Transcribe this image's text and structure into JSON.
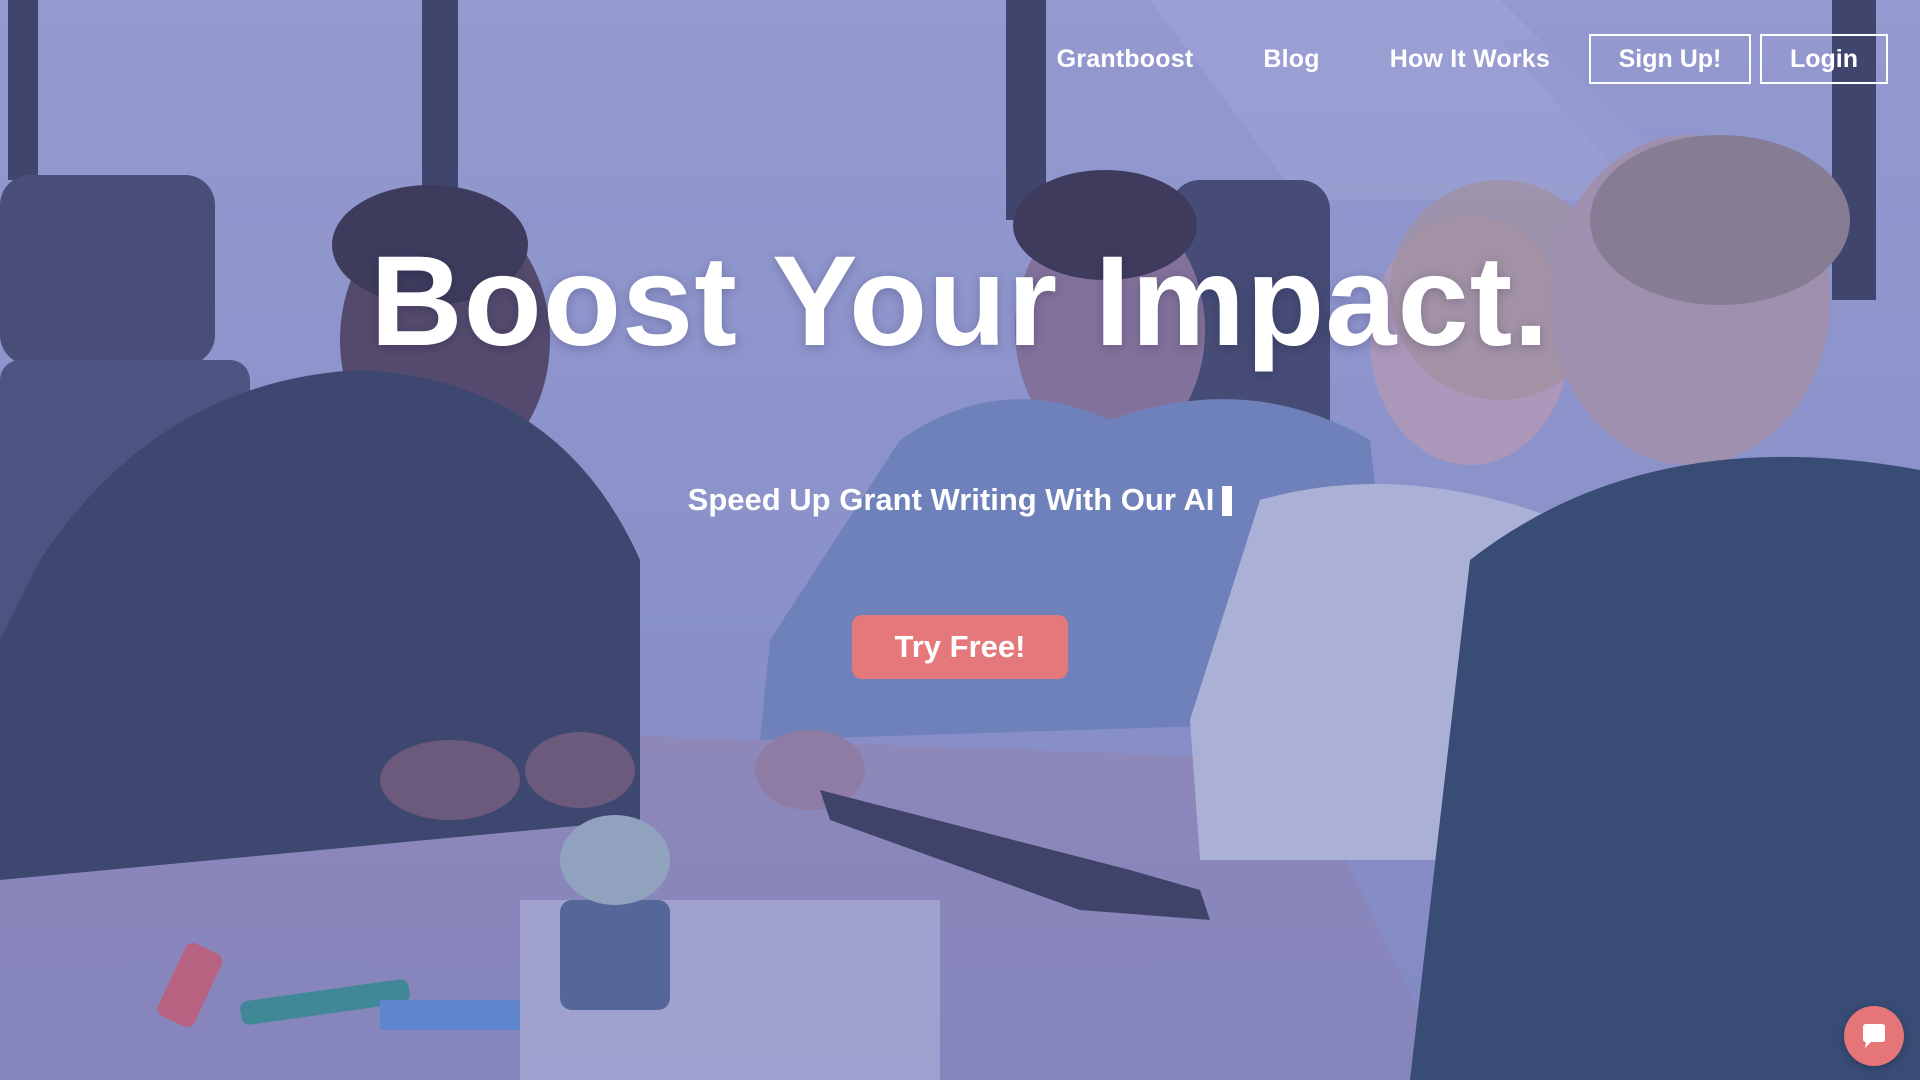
{
  "nav": {
    "links": [
      {
        "label": "Grantboost"
      },
      {
        "label": "Blog"
      },
      {
        "label": "How It Works"
      }
    ],
    "signup_label": "Sign Up!",
    "login_label": "Login"
  },
  "hero": {
    "headline": "Boost Your Impact.",
    "subheadline": "Speed Up Grant Writing With Our AI",
    "cta_label": "Try Free!"
  },
  "colors": {
    "cta": "#e5787a",
    "overlay": "#7f86bd",
    "chat_button": "#e6757a"
  },
  "icons": {
    "chat": "chat-bubble-icon"
  }
}
